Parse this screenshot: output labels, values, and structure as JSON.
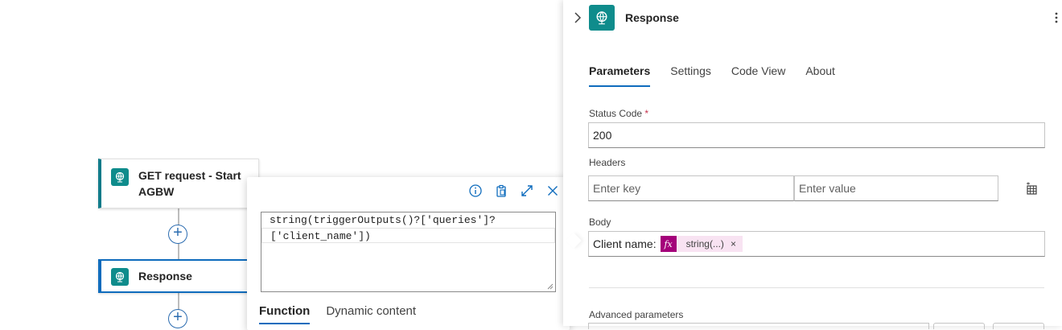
{
  "canvas": {
    "trigger_card": {
      "title": "GET request - Start AGBW",
      "icon": "request-globe-icon"
    },
    "response_card": {
      "title": "Response",
      "icon": "request-globe-icon"
    },
    "add_icon": "+"
  },
  "expression_popup": {
    "code_lines": [
      "string(triggerOutputs()?['queries']?",
      "['client_name'])"
    ],
    "tabs": [
      {
        "label": "Function",
        "active": true
      },
      {
        "label": "Dynamic content",
        "active": false
      }
    ],
    "tools": [
      "info-icon",
      "clipboard-icon",
      "expand-icon",
      "close-icon"
    ]
  },
  "panel": {
    "title": "Response",
    "tabs": [
      {
        "label": "Parameters",
        "active": true
      },
      {
        "label": "Settings",
        "active": false
      },
      {
        "label": "Code View",
        "active": false
      },
      {
        "label": "About",
        "active": false
      }
    ],
    "status_code": {
      "label": "Status Code",
      "required_mark": "*",
      "value": "200"
    },
    "headers": {
      "label": "Headers",
      "key_placeholder": "Enter key",
      "value_placeholder": "Enter value"
    },
    "body": {
      "label": "Body",
      "prefix_text": "Client name:",
      "token_fx": "fx",
      "token_label": "string(...)",
      "token_remove": "×"
    },
    "advanced": {
      "label": "Advanced parameters"
    }
  },
  "colors": {
    "accent": "#0f6cbd",
    "connector_teal": "#0f8c8c",
    "expression_token": "#a4007a",
    "token_bg": "#f8e3f2"
  }
}
